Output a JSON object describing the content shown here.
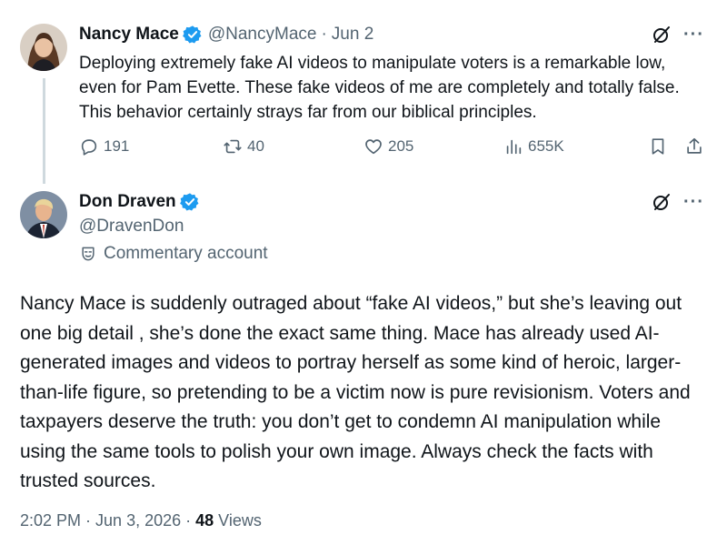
{
  "tweet1": {
    "author_name": "Nancy Mace",
    "handle": "@NancyMace",
    "separator": "·",
    "date": "Jun 2",
    "text": "Deploying extremely fake AI videos to manipulate voters is a remarkable low, even for Pam Evette. These fake videos of me are completely and totally false. This behavior certainly strays far from our biblical principles.",
    "replies": "191",
    "reposts": "40",
    "likes": "205",
    "views": "655K",
    "more": "···"
  },
  "tweet2": {
    "author_name": "Don Draven",
    "handle": "@DravenDon",
    "label": "Commentary account",
    "text": "Nancy Mace is suddenly outraged about “fake AI videos,” but she’s leaving out one big detail , she’s done the exact same thing. Mace has already used AI-generated images and videos to portray herself as some kind of heroic, larger-than-life figure, so pretending to be a victim now is pure revisionism. Voters and taxpayers deserve the truth: you don’t get to condemn AI manipulation while using the same tools to polish your own image. Always check the facts with trusted sources.",
    "time": "2:02 PM",
    "dot1": "·",
    "date": "Jun 3, 2026",
    "dot2": "·",
    "view_count": "48",
    "views_label": "Views",
    "more": "···"
  },
  "icons": {
    "verified": "verified-badge-icon",
    "grok": "grok-icon",
    "more": "more-icon",
    "reply": "reply-icon",
    "repost": "repost-icon",
    "like": "heart-icon",
    "views": "views-chart-icon",
    "bookmark": "bookmark-icon",
    "share": "share-icon",
    "commentary": "mask-icon"
  },
  "colors": {
    "text": "#0f1419",
    "muted": "#536471",
    "verified_blue": "#1d9bf0",
    "thread_line": "#cfd9de"
  }
}
